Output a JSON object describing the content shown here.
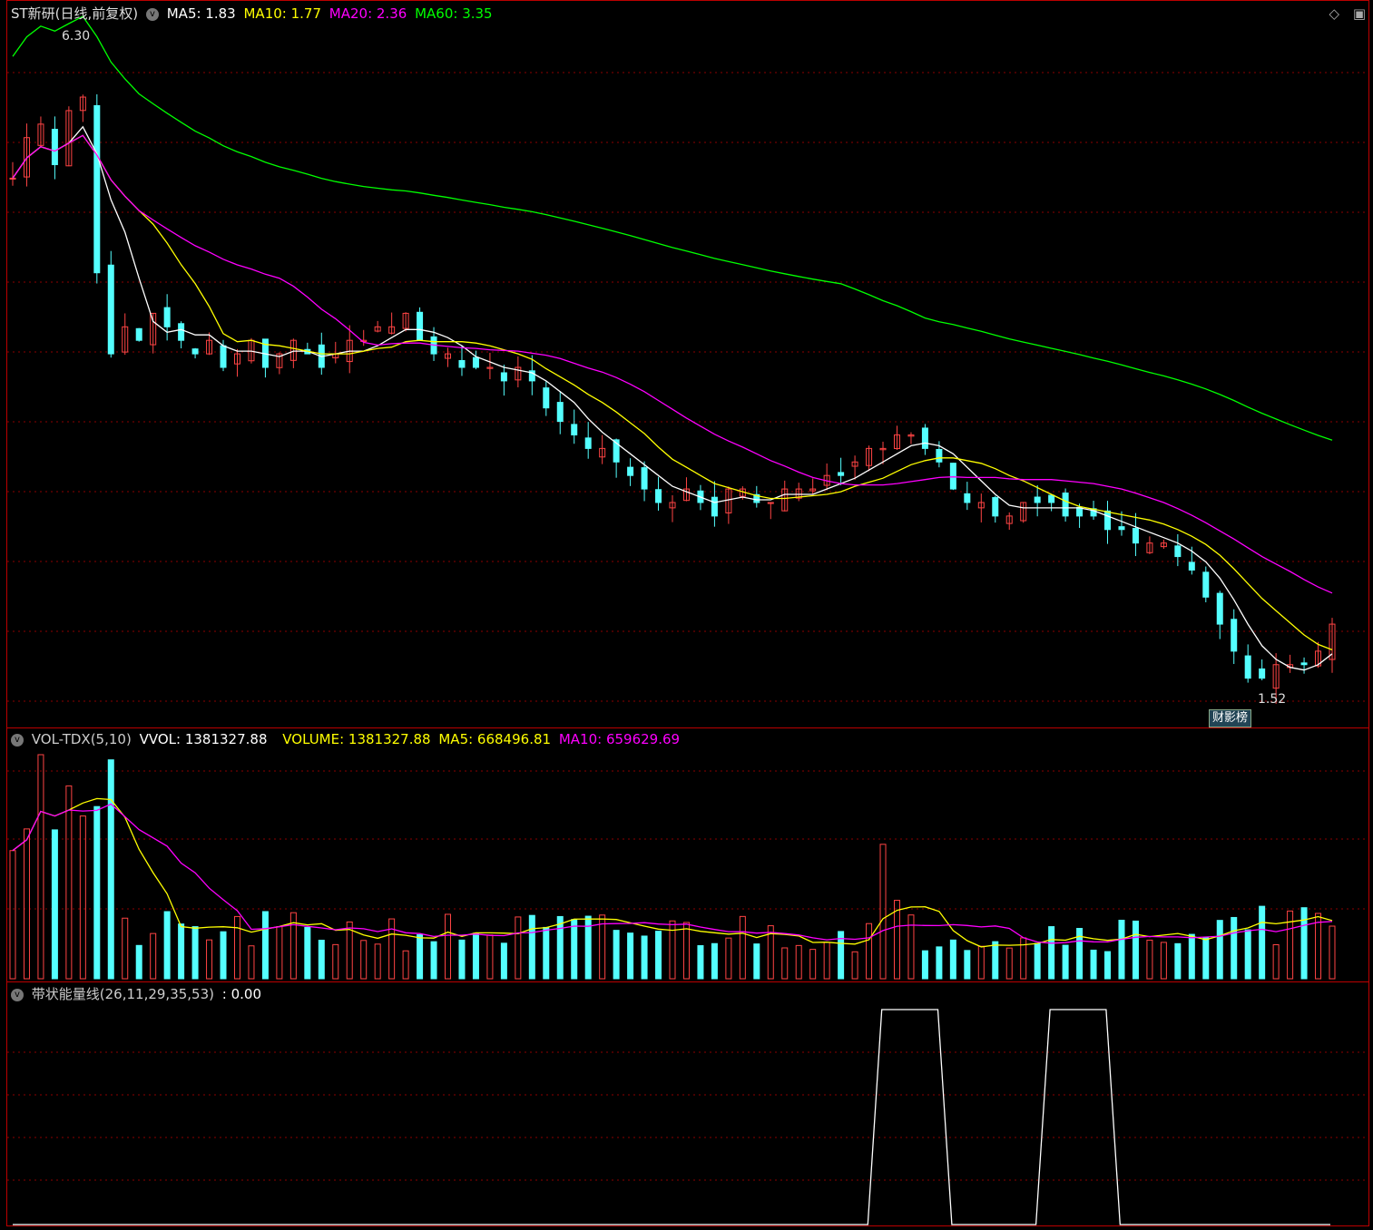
{
  "price_panel": {
    "title": "ST新研(日线,前复权)",
    "ma5_label": "MA5: 1.83",
    "ma10_label": "MA10: 1.77",
    "ma20_label": "MA20: 2.36",
    "ma60_label": "MA60: 3.35",
    "high_label": "6.30",
    "low_label": "1.52",
    "badge": "财影榜"
  },
  "volume_panel": {
    "indicator": "VOL-TDX(5,10)",
    "vvol_label": "VVOL: 1381327.88",
    "volume_label": "VOLUME: 1381327.88",
    "ma5_label": "MA5: 668496.81",
    "ma10_label": "MA10: 659629.69"
  },
  "energy_panel": {
    "indicator": "带状能量线(26,11,29,35,53)",
    "value_label": ": 0.00"
  },
  "colors": {
    "up": "#ff4444",
    "down": "#54ffff",
    "ma5": "#ffffff",
    "ma10": "#ffff00",
    "ma20": "#ff00ff",
    "ma60": "#00ff00",
    "grid": "#8b0000",
    "frame": "#b00000"
  },
  "icons": {
    "collapse": "chevron-down-icon",
    "draw": "diamond-icon",
    "window": "window-icon"
  },
  "chart_data": [
    {
      "type": "candlestick",
      "title": "ST新研(日线,前复权)",
      "ylim": [
        1.3,
        6.5
      ],
      "annotations": {
        "high": 6.3,
        "low": 1.52
      },
      "ma_latest": {
        "MA5": 1.83,
        "MA10": 1.77,
        "MA20": 2.36,
        "MA60": 3.35
      },
      "close": [
        5.3,
        5.6,
        5.7,
        5.4,
        5.8,
        5.9,
        4.6,
        4.0,
        4.2,
        4.1,
        4.3,
        4.2,
        4.1,
        4.0,
        4.1,
        3.9,
        4.0,
        4.1,
        3.9,
        4.0,
        4.1,
        4.0,
        3.9,
        4.0,
        4.1,
        4.1,
        4.2,
        4.2,
        4.3,
        4.1,
        4.0,
        4.0,
        3.9,
        3.9,
        3.9,
        3.8,
        3.9,
        3.8,
        3.6,
        3.5,
        3.4,
        3.3,
        3.3,
        3.2,
        3.1,
        3.0,
        2.9,
        2.9,
        3.0,
        2.9,
        2.8,
        3.0,
        3.0,
        2.9,
        2.9,
        3.0,
        3.0,
        3.0,
        3.1,
        3.1,
        3.2,
        3.3,
        3.3,
        3.4,
        3.4,
        3.3,
        3.2,
        3.0,
        2.9,
        2.9,
        2.8,
        2.8,
        2.9,
        2.9,
        2.9,
        2.8,
        2.8,
        2.8,
        2.7,
        2.7,
        2.6,
        2.6,
        2.6,
        2.5,
        2.4,
        2.2,
        2.0,
        1.8,
        1.6,
        1.6,
        1.7,
        1.7,
        1.7,
        1.8,
        2.0
      ]
    },
    {
      "type": "bar",
      "title": "VOL-TDX(5,10)",
      "latest": {
        "VVOL": 1381327.88,
        "MA5": 668496.81,
        "MA10": 659629.69
      }
    },
    {
      "type": "line",
      "title": "带状能量线(26,11,29,35,53)",
      "latest": 0.0,
      "values": [
        0,
        0,
        0,
        0,
        0,
        0,
        0,
        0,
        0,
        0,
        0,
        0,
        0,
        0,
        0,
        0,
        0,
        0,
        0,
        0,
        0,
        0,
        0,
        0,
        0,
        0,
        0,
        0,
        0,
        0,
        0,
        0,
        0,
        0,
        0,
        0,
        0,
        0,
        0,
        0,
        0,
        0,
        0,
        0,
        0,
        0,
        0,
        0,
        0,
        0,
        0,
        0,
        0,
        0,
        0,
        0,
        0,
        0,
        0,
        0,
        0,
        0,
        1,
        1,
        1,
        1,
        1,
        0,
        0,
        0,
        0,
        0,
        0,
        0,
        1,
        1,
        1,
        1,
        1,
        0,
        0,
        0,
        0,
        0,
        0,
        0,
        0,
        0,
        0,
        0,
        0,
        0,
        0,
        0,
        0
      ]
    }
  ]
}
